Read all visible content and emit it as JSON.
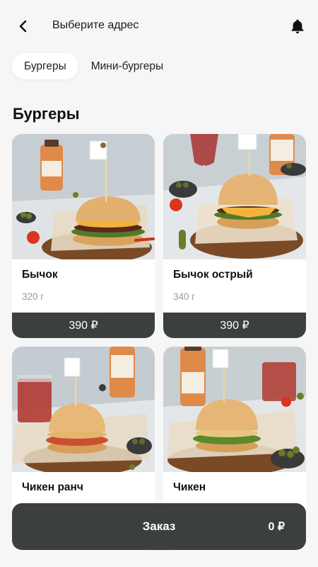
{
  "header": {
    "address": "Выберите адрес",
    "back_icon": "chevron-left-icon",
    "bell_icon": "bell-icon"
  },
  "tabs": [
    {
      "label": "Бургеры",
      "active": true
    },
    {
      "label": "Мини-бургеры",
      "active": false
    }
  ],
  "section": {
    "title": "Бургеры"
  },
  "products": [
    {
      "name": "Бычок",
      "weight": "320 г",
      "price": "390 ₽"
    },
    {
      "name": "Бычок острый",
      "weight": "340 г",
      "price": "390 ₽"
    },
    {
      "name": "Чикен ранч",
      "weight": "",
      "price": ""
    },
    {
      "name": "Чикен",
      "weight": "",
      "price": ""
    }
  ],
  "order": {
    "label": "Заказ",
    "total": "0 ₽"
  },
  "colors": {
    "dark_button": "#3c3f3f",
    "background": "#f6f6f6"
  }
}
